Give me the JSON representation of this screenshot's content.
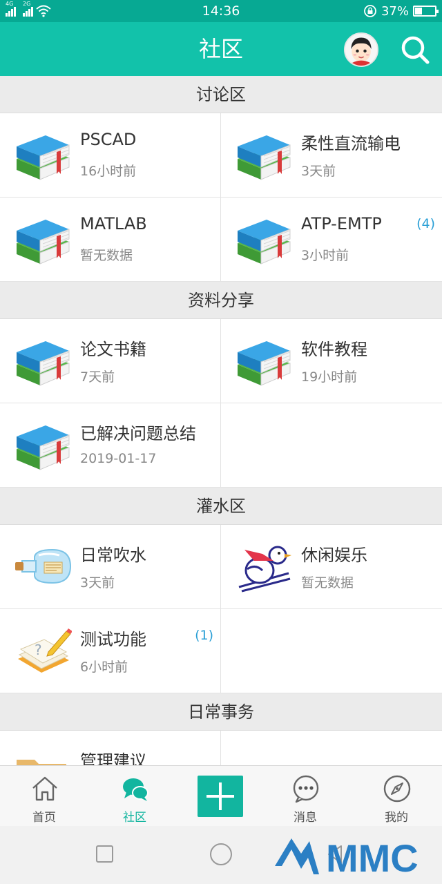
{
  "status_bar": {
    "time": "14:36",
    "battery_text": "37%",
    "battery_level": 0.37,
    "network_1": "4G",
    "network_2": "2G"
  },
  "header": {
    "title": "社区",
    "avatar_icon": "user-avatar",
    "search_icon": "search-icon"
  },
  "sections": [
    {
      "title": "讨论区",
      "items": [
        {
          "title": "PSCAD",
          "sub": "16小时前",
          "badge": "",
          "icon": "books-icon"
        },
        {
          "title": "柔性直流输电",
          "sub": "3天前",
          "badge": "",
          "icon": "books-icon"
        },
        {
          "title": "MATLAB",
          "sub": "暂无数据",
          "badge": "",
          "icon": "books-icon"
        },
        {
          "title": "ATP-EMTP",
          "sub": "3小时前",
          "badge": "(4)",
          "icon": "books-icon"
        }
      ]
    },
    {
      "title": "资料分享",
      "items": [
        {
          "title": "论文书籍",
          "sub": "7天前",
          "badge": "",
          "icon": "books-icon"
        },
        {
          "title": "软件教程",
          "sub": "19小时前",
          "badge": "",
          "icon": "books-icon"
        },
        {
          "title": "已解决问题总结",
          "sub": "2019-01-17",
          "badge": "",
          "icon": "books-icon"
        }
      ]
    },
    {
      "title": "灌水区",
      "items": [
        {
          "title": "日常吹水",
          "sub": "3天前",
          "badge": "",
          "icon": "bottle-icon"
        },
        {
          "title": "休闲娱乐",
          "sub": "暂无数据",
          "badge": "",
          "icon": "skiing-bird-icon"
        },
        {
          "title": "测试功能",
          "sub": "6小时前",
          "badge": "(1)",
          "icon": "notebook-pencil-icon"
        }
      ]
    },
    {
      "title": "日常事务",
      "items": [
        {
          "title": "管理建议",
          "sub": "",
          "badge": "",
          "icon": "folder-icon"
        }
      ]
    }
  ],
  "bottom_nav": {
    "home": "首页",
    "community": "社区",
    "messages": "消息",
    "mine": "我的"
  },
  "colors": {
    "status_bar": "#07a993",
    "header": "#12c2aa",
    "accent": "#12b59f",
    "badge": "#2a9fd6",
    "watermark": "#2b7fc4"
  },
  "watermark_text": "MMC"
}
